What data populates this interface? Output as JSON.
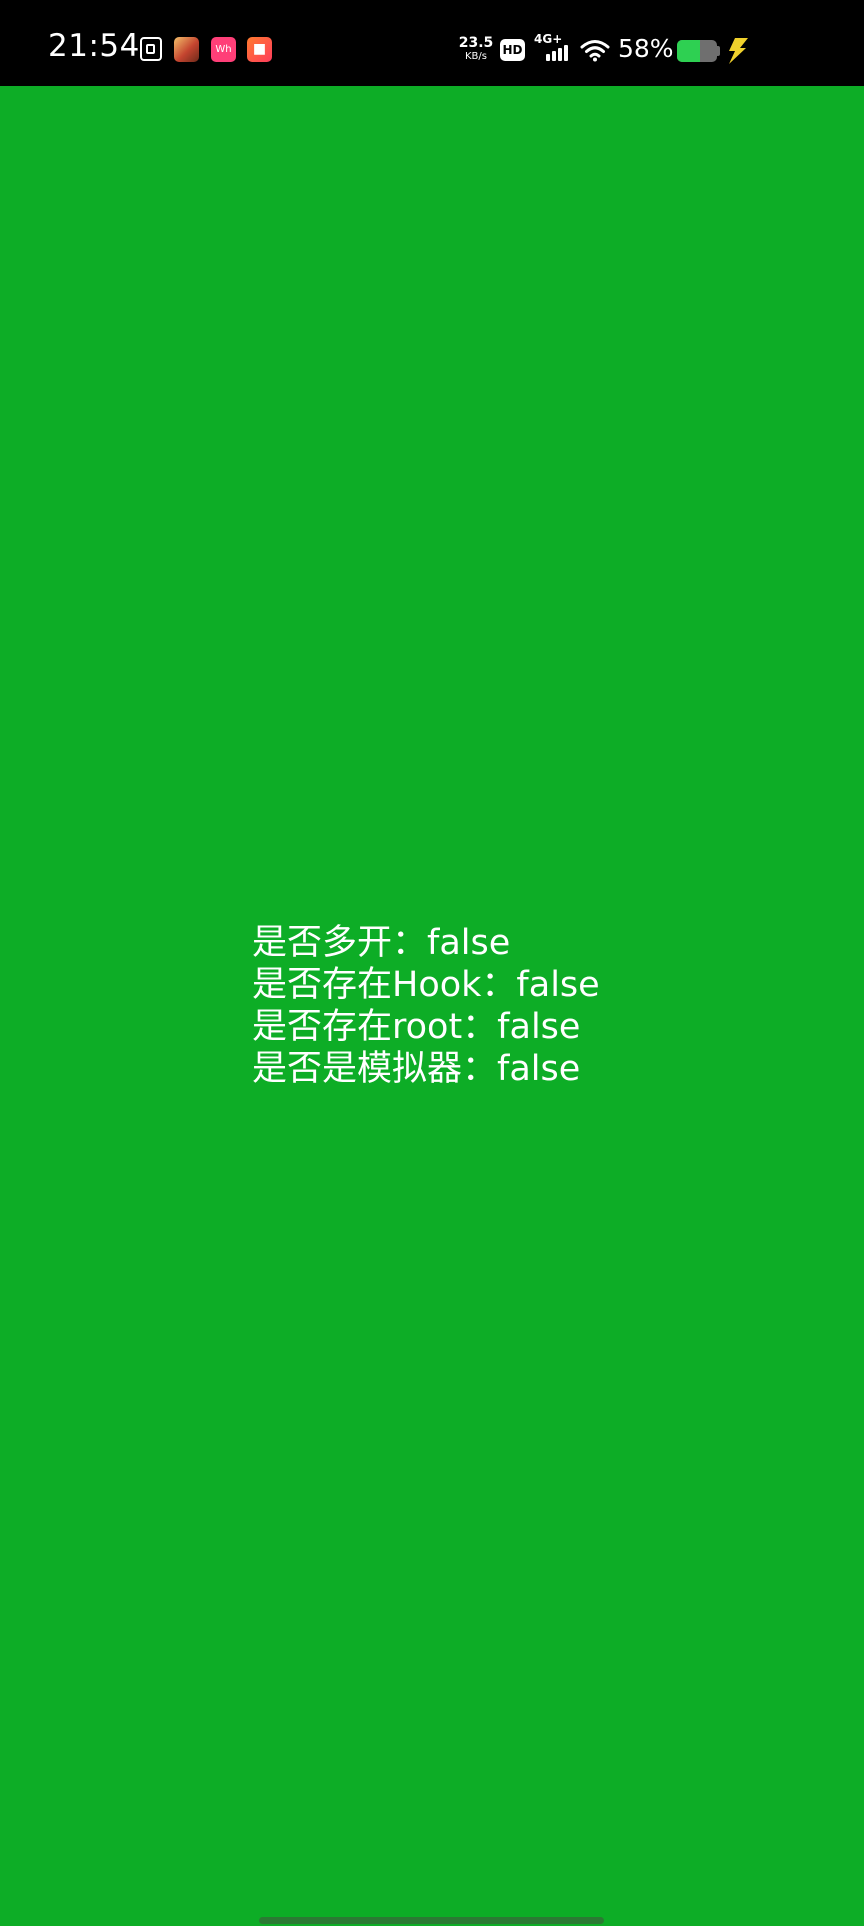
{
  "status_bar": {
    "time": "21:54",
    "notification_icons": [
      "document-icon",
      "game-app-icon",
      "pink-app-icon",
      "video-app-icon"
    ],
    "pink_app_text": "Wh",
    "net_speed_value": "23.5",
    "net_speed_unit": "KB/s",
    "hd_badge": "HD",
    "network_type": "4G+",
    "battery_percent": "58%",
    "battery_level": 0.58,
    "battery_color": "#2ed052",
    "charging_color": "#f0d12c"
  },
  "background_color": "#0dad26",
  "results": [
    {
      "label": "是否多开：",
      "value": "false"
    },
    {
      "label": "是否存在Hook：",
      "value": "false"
    },
    {
      "label": "是否存在root：",
      "value": "false"
    },
    {
      "label": "是否是模拟器：",
      "value": "false"
    }
  ]
}
